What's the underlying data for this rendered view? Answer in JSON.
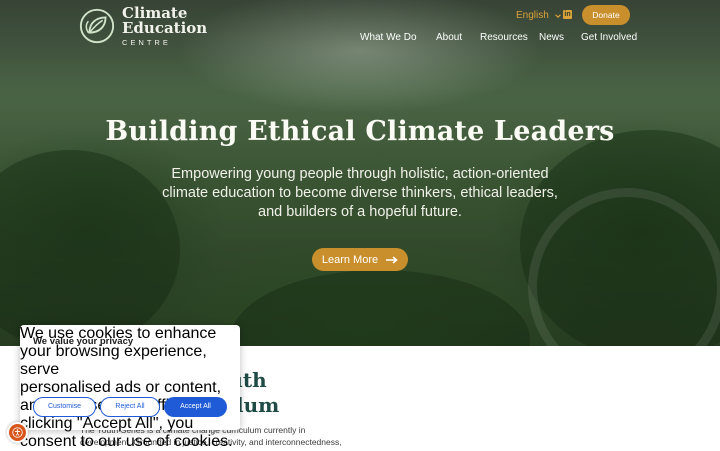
{
  "header": {
    "logo": {
      "line1": "Climate",
      "line2": "Education",
      "line3": "CENTRE"
    },
    "language": "English",
    "donate_label": "Donate",
    "nav": [
      "What We Do",
      "About",
      "Resources",
      "News",
      "Get Involved"
    ]
  },
  "hero": {
    "title": "Building Ethical Climate Leaders",
    "subtitle_lines": [
      "Empowering young people through holistic, action-oriented",
      "climate education to become diverse thinkers, ethical leaders,",
      "and builders of a hopeful future."
    ],
    "cta_label": "Learn More"
  },
  "section": {
    "title_lines": [
      "outh",
      "lum"
    ],
    "body_lines": [
      "The Youth Series is a climate change curriculum currently in",
      "development. Grounded in justice, creativity, and interconnectedness,"
    ]
  },
  "cookie": {
    "title": "We value your privacy",
    "text_lines": [
      "We use cookies to enhance your browsing experience, serve",
      "personalised ads or content, and analyse our traffic. By",
      "clicking \"Accept All\", you consent to our use of cookies."
    ],
    "customise_label": "Customise",
    "reject_label": "Reject All",
    "accept_label": "Accept All"
  },
  "colors": {
    "accent_gold": "#c98f2c",
    "heading_teal": "#1f4a45",
    "cookie_blue": "#1f5bd6",
    "a11y_orange": "#d7561c"
  },
  "icons": {
    "logo": "leaf-circle-logo-icon",
    "language": "chevron-down-icon",
    "social": "linkedin-icon",
    "cta": "arrow-right-icon",
    "accessibility": "accessibility-icon"
  }
}
